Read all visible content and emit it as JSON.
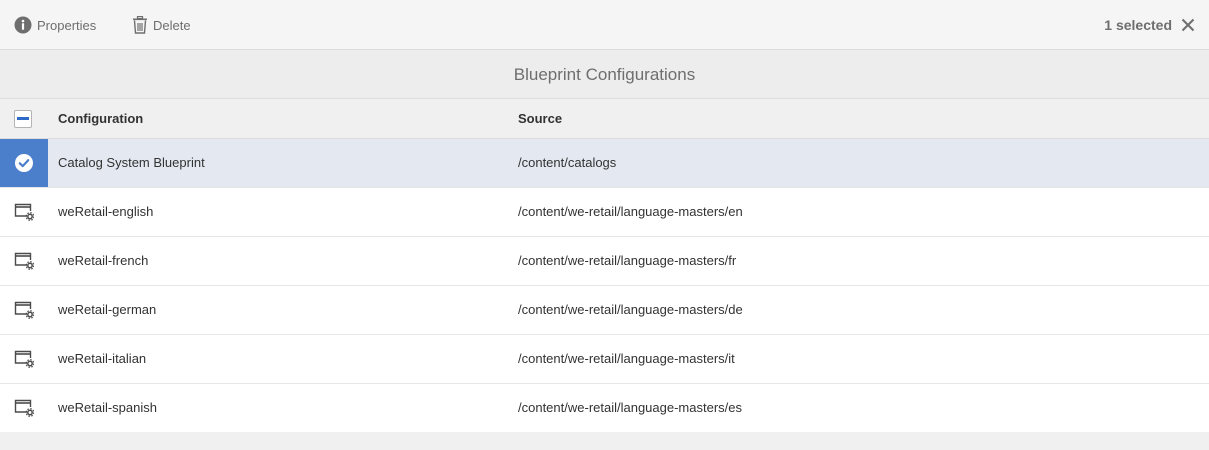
{
  "toolbar": {
    "properties_label": "Properties",
    "delete_label": "Delete",
    "selected_count": "1 selected"
  },
  "title": "Blueprint Configurations",
  "table": {
    "columns": [
      "Configuration",
      "Source"
    ],
    "rows": [
      {
        "configuration": "Catalog System Blueprint",
        "source": "/content/catalogs",
        "selected": true
      },
      {
        "configuration": "weRetail-english",
        "source": "/content/we-retail/language-masters/en",
        "selected": false
      },
      {
        "configuration": "weRetail-french",
        "source": "/content/we-retail/language-masters/fr",
        "selected": false
      },
      {
        "configuration": "weRetail-german",
        "source": "/content/we-retail/language-masters/de",
        "selected": false
      },
      {
        "configuration": "weRetail-italian",
        "source": "/content/we-retail/language-masters/it",
        "selected": false
      },
      {
        "configuration": "weRetail-spanish",
        "source": "/content/we-retail/language-masters/es",
        "selected": false
      }
    ]
  },
  "icons": {
    "properties": "info-icon",
    "delete": "trash-icon",
    "close": "close-icon",
    "selected_row": "checkmark-circle-icon",
    "row": "blueprint-config-icon"
  },
  "colors": {
    "accent": "#4b7fcc",
    "selected_row_bg": "#e4e9f1",
    "header_check": "#2d6ac7"
  }
}
